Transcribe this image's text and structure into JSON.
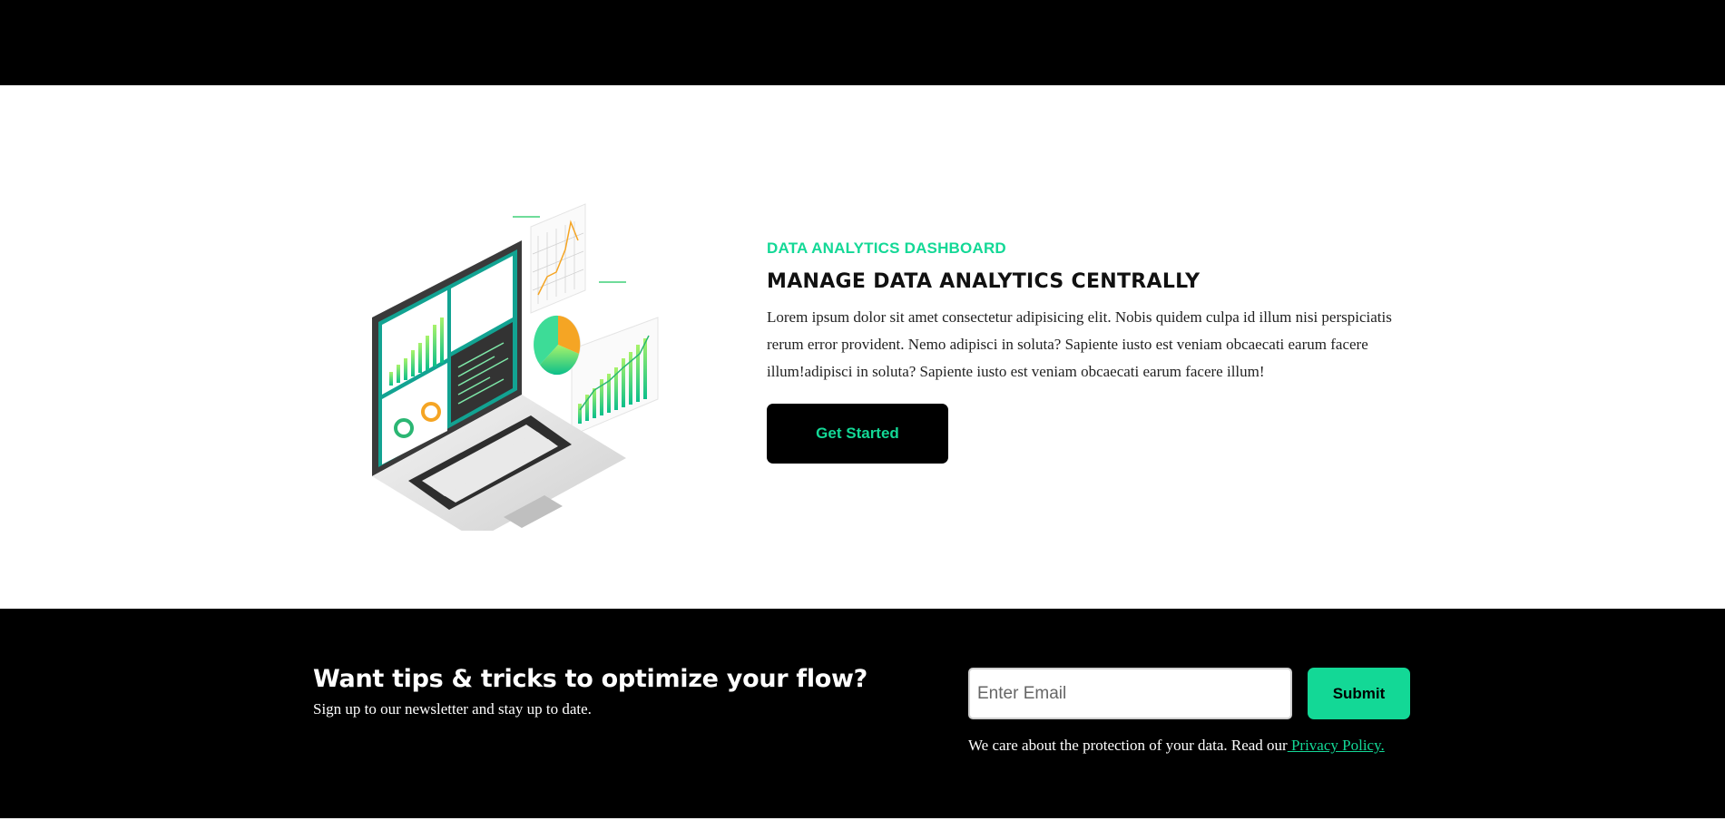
{
  "hero": {
    "eyebrow": "DATA ANALYTICS DASHBOARD",
    "headline": "MANAGE DATA ANALYTICS CENTRALLY",
    "body": "Lorem ipsum dolor sit amet consectetur adipisicing elit. Nobis quidem culpa id illum nisi perspiciatis rerum error provident. Nemo adipisci in soluta? Sapiente iusto est veniam obcaecati earum facere illum!adipisci in soluta? Sapiente iusto est veniam obcaecati earum facere illum!",
    "cta_label": "Get Started",
    "illustration_icon": "laptop-analytics-illustration"
  },
  "newsletter": {
    "title": "Want tips & tricks to optimize your flow?",
    "subtitle": "Sign up to our newsletter and stay up to date.",
    "email_placeholder": "Enter Email",
    "email_value": "",
    "submit_label": "Submit",
    "privacy_text": "We care about the protection of your data. Read our",
    "privacy_link": " Privacy Policy."
  },
  "colors": {
    "accent": "#13d896",
    "dark": "#000000",
    "light": "#ffffff"
  }
}
